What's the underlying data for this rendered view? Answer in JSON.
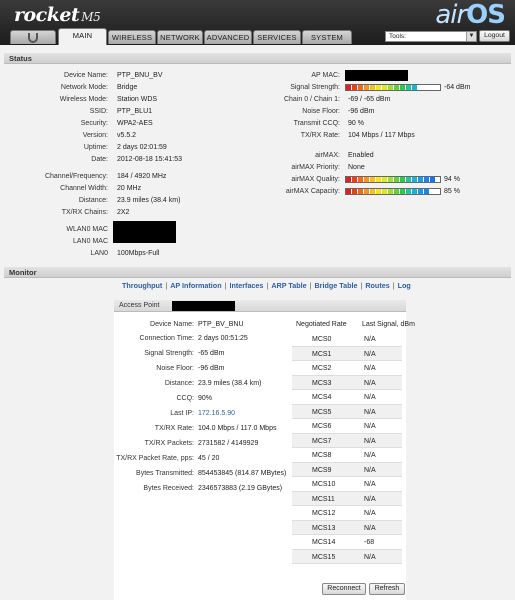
{
  "header": {
    "brand": "rocket",
    "model": "M5",
    "product": "airOS",
    "product_air": "air",
    "product_os": "OS",
    "logo_icon": "ubiquiti-u-icon"
  },
  "tabs": [
    "MAIN",
    "WIRELESS",
    "NETWORK",
    "ADVANCED",
    "SERVICES",
    "SYSTEM"
  ],
  "active_tab": "MAIN",
  "tools": {
    "selected": "Tools:"
  },
  "logout_label": "Logout",
  "status": {
    "title": "Status",
    "left": [
      {
        "label": "Device Name:",
        "value": "PTP_BNU_BV"
      },
      {
        "label": "Network Mode:",
        "value": "Bridge"
      },
      {
        "label": "Wireless Mode:",
        "value": "Station WDS"
      },
      {
        "label": "SSID:",
        "value": "PTP_BLU1"
      },
      {
        "label": "Security:",
        "value": "WPA2-AES"
      },
      {
        "label": "Version:",
        "value": "v5.5.2"
      },
      {
        "label": "Uptime:",
        "value": "2 days 02:01:59"
      },
      {
        "label": "Date:",
        "value": "2012-08-18 15:41:53"
      },
      {
        "label": "Channel/Frequency:",
        "value": "184 / 4920 MHz"
      },
      {
        "label": "Channel Width:",
        "value": "20 MHz"
      },
      {
        "label": "Distance:",
        "value": "23.9 miles (38.4 km)"
      },
      {
        "label": "TX/RX Chains:",
        "value": "2X2"
      },
      {
        "label": "WLAN0 MAC",
        "value": ""
      },
      {
        "label": "LAN0 MAC",
        "value": ""
      },
      {
        "label": "LAN0",
        "value": "100Mbps-Full"
      }
    ],
    "right": [
      {
        "label": "AP MAC:",
        "value": ""
      },
      {
        "label": "Signal Strength:",
        "value": "-64 dBm"
      },
      {
        "label": "Chain 0 / Chain 1:",
        "value": "-69 / -65 dBm"
      },
      {
        "label": "Noise Floor:",
        "value": "-96 dBm"
      },
      {
        "label": "Transmit CCQ:",
        "value": "90 %"
      },
      {
        "label": "TX/RX Rate:",
        "value": "104 Mbps / 117 Mbps"
      },
      {
        "label": "airMAX:",
        "value": "Enabled"
      },
      {
        "label": "airMAX Priority:",
        "value": "None"
      },
      {
        "label": "airMAX Quality:",
        "value": "94 %"
      },
      {
        "label": "airMAX Capacity:",
        "value": "85 %"
      }
    ],
    "signal_strength_fill": 0.78,
    "airmax_quality_fill": 0.94,
    "airmax_capacity_fill": 0.85
  },
  "monitor": {
    "title": "Monitor",
    "links": [
      "Throughput",
      "AP Information",
      "Interfaces",
      "ARP Table",
      "Bridge Table",
      "Routes",
      "Log"
    ],
    "panel_title": "Access Point",
    "info": [
      {
        "label": "Device Name:",
        "value": "PTP_BV_BNU"
      },
      {
        "label": "Connection Time:",
        "value": "2 days 00:51:25"
      },
      {
        "label": "Signal Strength:",
        "value": "-65 dBm"
      },
      {
        "label": "Noise Floor:",
        "value": "-96 dBm"
      },
      {
        "label": "Distance:",
        "value": "23.9 miles (38.4 km)"
      },
      {
        "label": "CCQ:",
        "value": "90%"
      },
      {
        "label": "Last IP:",
        "value": "172.16.5.90"
      },
      {
        "label": "TX/RX Rate:",
        "value": "104.0 Mbps / 117.0 Mbps"
      },
      {
        "label": "TX/RX Packets:",
        "value": "2731582 / 4149929"
      },
      {
        "label": "TX/RX Packet Rate, pps:",
        "value": "45 / 20"
      },
      {
        "label": "Bytes Transmitted:",
        "value": "854453845 (814.87 MBytes)"
      },
      {
        "label": "Bytes Received:",
        "value": "2346573883 (2.19 GBytes)"
      }
    ],
    "rate_header": "Negotiated Rate",
    "signal_header": "Last Signal, dBm",
    "rates": [
      {
        "rate": "MCS0",
        "signal": "N/A"
      },
      {
        "rate": "MCS1",
        "signal": "N/A"
      },
      {
        "rate": "MCS2",
        "signal": "N/A"
      },
      {
        "rate": "MCS3",
        "signal": "N/A"
      },
      {
        "rate": "MCS4",
        "signal": "N/A"
      },
      {
        "rate": "MCS5",
        "signal": "N/A"
      },
      {
        "rate": "MCS6",
        "signal": "N/A"
      },
      {
        "rate": "MCS7",
        "signal": "N/A"
      },
      {
        "rate": "MCS8",
        "signal": "N/A"
      },
      {
        "rate": "MCS9",
        "signal": "N/A"
      },
      {
        "rate": "MCS10",
        "signal": "N/A"
      },
      {
        "rate": "MCS11",
        "signal": "N/A"
      },
      {
        "rate": "MCS12",
        "signal": "N/A"
      },
      {
        "rate": "MCS13",
        "signal": "N/A"
      },
      {
        "rate": "MCS14",
        "signal": "-68"
      },
      {
        "rate": "MCS15",
        "signal": "N/A"
      }
    ],
    "reconnect_label": "Reconnect",
    "refresh_label": "Refresh"
  }
}
